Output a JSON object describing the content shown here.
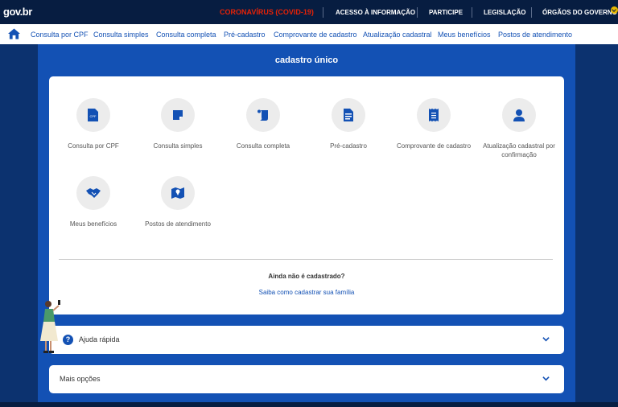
{
  "topbar": {
    "logo": "gov.br",
    "covid": "CORONAVÍRUS (COVID-19)",
    "links": [
      "ACESSO À INFORMAÇÃO",
      "PARTICIPE",
      "LEGISLAÇÃO",
      "ÓRGÃOS DO GOVERNO"
    ]
  },
  "nav": {
    "links": [
      "Consulta por CPF",
      "Consulta simples",
      "Consulta completa",
      "Pré-cadastro",
      "Comprovante de cadastro",
      "Atualização cadastral",
      "Meus benefícios",
      "Postos de atendimento"
    ]
  },
  "main": {
    "title": "cadastro único",
    "tiles": [
      {
        "label": "Consulta por CPF",
        "icon": "cpf-document-icon"
      },
      {
        "label": "Consulta simples",
        "icon": "note-icon"
      },
      {
        "label": "Consulta completa",
        "icon": "scroll-icon"
      },
      {
        "label": "Pré-cadastro",
        "icon": "form-icon"
      },
      {
        "label": "Comprovante de cadastro",
        "icon": "receipt-icon"
      },
      {
        "label": "Atualização cadastral por confirmação",
        "icon": "user-icon"
      },
      {
        "label": "Meus benefícios",
        "icon": "handshake-icon"
      },
      {
        "label": "Postos de atendimento",
        "icon": "map-pin-icon"
      }
    ],
    "ask": "Ainda não é cadastrado?",
    "learn": "Saiba como cadastrar sua família"
  },
  "panels": {
    "help": "Ajuda rápida",
    "more": "Mais opções"
  },
  "colors": {
    "accent": "#1351b4",
    "topbar": "#071d41",
    "covid": "#e52207"
  }
}
